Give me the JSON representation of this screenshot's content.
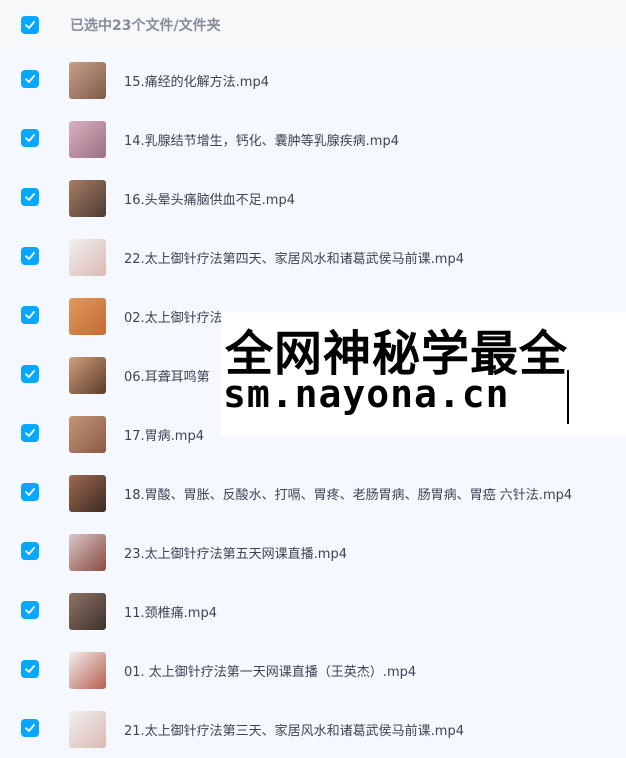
{
  "header": {
    "selection_label": "已选中23个文件/文件夹"
  },
  "files": [
    {
      "name": "15.痛经的化解方法.mp4",
      "thumb": [
        "#c9a089",
        "#7d5a4a"
      ]
    },
    {
      "name": "14.乳腺结节增生，钙化、囊肿等乳腺疾病.mp4",
      "thumb": [
        "#d9b2bd",
        "#9c6e86"
      ]
    },
    {
      "name": "16.头晕头痛脑供血不足.mp4",
      "thumb": [
        "#a87d64",
        "#4b3b33"
      ]
    },
    {
      "name": "22.太上御针疗法第四天、家居风水和诸葛武侯马前课.mp4",
      "thumb": [
        "#f2f0f0",
        "#d9b9b3"
      ]
    },
    {
      "name": "02.太上御针疗法",
      "thumb": [
        "#e09a61",
        "#c46a32"
      ]
    },
    {
      "name": "06.耳聋耳鸣第",
      "thumb": [
        "#d0a07e",
        "#5c3a2a"
      ]
    },
    {
      "name": "17.胃病.mp4",
      "thumb": [
        "#c5957a",
        "#8a5a44"
      ]
    },
    {
      "name": "18.胃酸、胃胀、反酸水、打嗝、胃疼、老肠胃病、肠胃病、胃癌 六针法.mp4",
      "thumb": [
        "#9d6a4f",
        "#3d2b24"
      ]
    },
    {
      "name": "23.太上御针疗法第五天网课直播.mp4",
      "thumb": [
        "#d6c7c4",
        "#8c4a45"
      ]
    },
    {
      "name": "11.颈椎痛.mp4",
      "thumb": [
        "#8f7467",
        "#3e302c"
      ]
    },
    {
      "name": "01. 太上御针疗法第一天网课直播（王英杰）.mp4",
      "thumb": [
        "#f3eeee",
        "#b6604f"
      ]
    },
    {
      "name": "21.太上御针疗法第三天、家居风水和诸葛武侯马前课.mp4",
      "thumb": [
        "#f2f0f0",
        "#d9b9b3"
      ]
    }
  ],
  "watermark": {
    "line1": "全网神秘学最全",
    "line2": "sm.nayona.cn"
  },
  "colors": {
    "accent": "#06a7ff",
    "background": "#f5f9ff"
  }
}
